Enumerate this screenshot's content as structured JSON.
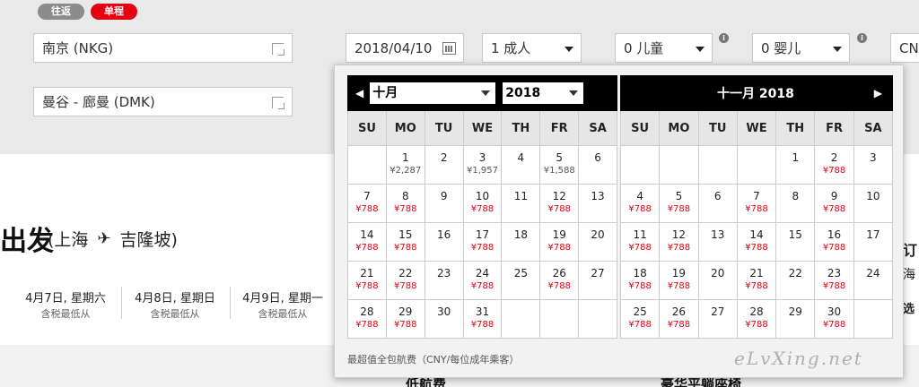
{
  "trip": {
    "roundtrip": "往返",
    "oneway": "单程"
  },
  "search": {
    "from": "南京 (NKG)",
    "to": "曼谷 - 廊曼 (DMK)",
    "date": "2018/04/10",
    "adults": "1 成人",
    "children": "0 儿童",
    "infants": "0 婴儿",
    "currency": "CNY",
    "info_glyph": "i"
  },
  "page": {
    "heading": "出发",
    "route_from": "(上海",
    "route_to": "吉隆坡)",
    "days": [
      {
        "date": "4月7日, 星期六",
        "sub": "含税最低从"
      },
      {
        "date": "4月8日, 星期日",
        "sub": "含税最低从"
      },
      {
        "date": "4月9日, 星期一",
        "sub": "含税最低从"
      }
    ],
    "bottom_left": "低航费",
    "bottom_right": "豪华平躺座椅",
    "right_peek": [
      "订",
      "海",
      "选"
    ]
  },
  "calendar": {
    "left_month": "十月",
    "left_year": "2018",
    "right_title": "十一月  2018",
    "weekdays": [
      "SU",
      "MO",
      "TU",
      "WE",
      "TH",
      "FR",
      "SA"
    ],
    "footnote": "最超值全包航费（CNY/每位成年乘客）",
    "october": [
      {
        "n": "",
        "p": ""
      },
      {
        "n": "1",
        "p": "¥2,287",
        "c": "gray"
      },
      {
        "n": "2",
        "p": ""
      },
      {
        "n": "3",
        "p": "¥1,957",
        "c": "gray"
      },
      {
        "n": "4",
        "p": ""
      },
      {
        "n": "5",
        "p": "¥1,588",
        "c": "gray"
      },
      {
        "n": "6",
        "p": ""
      },
      {
        "n": "7",
        "p": "¥788",
        "c": "red"
      },
      {
        "n": "8",
        "p": "¥788",
        "c": "red"
      },
      {
        "n": "9",
        "p": ""
      },
      {
        "n": "10",
        "p": "¥788",
        "c": "red"
      },
      {
        "n": "11",
        "p": ""
      },
      {
        "n": "12",
        "p": "¥788",
        "c": "red"
      },
      {
        "n": "13",
        "p": ""
      },
      {
        "n": "14",
        "p": "¥788",
        "c": "red"
      },
      {
        "n": "15",
        "p": "¥788",
        "c": "red"
      },
      {
        "n": "16",
        "p": ""
      },
      {
        "n": "17",
        "p": "¥788",
        "c": "red"
      },
      {
        "n": "18",
        "p": ""
      },
      {
        "n": "19",
        "p": "¥788",
        "c": "red"
      },
      {
        "n": "20",
        "p": ""
      },
      {
        "n": "21",
        "p": "¥788",
        "c": "red"
      },
      {
        "n": "22",
        "p": "¥788",
        "c": "red"
      },
      {
        "n": "23",
        "p": ""
      },
      {
        "n": "24",
        "p": "¥788",
        "c": "red"
      },
      {
        "n": "25",
        "p": ""
      },
      {
        "n": "26",
        "p": "¥788",
        "c": "red"
      },
      {
        "n": "27",
        "p": ""
      },
      {
        "n": "28",
        "p": "¥788",
        "c": "red"
      },
      {
        "n": "29",
        "p": "¥788",
        "c": "red"
      },
      {
        "n": "30",
        "p": ""
      },
      {
        "n": "31",
        "p": "¥788",
        "c": "red"
      },
      {
        "n": "",
        "p": ""
      },
      {
        "n": "",
        "p": ""
      },
      {
        "n": "",
        "p": ""
      }
    ],
    "november": [
      {
        "n": "",
        "p": ""
      },
      {
        "n": "",
        "p": ""
      },
      {
        "n": "",
        "p": ""
      },
      {
        "n": "",
        "p": ""
      },
      {
        "n": "1",
        "p": ""
      },
      {
        "n": "2",
        "p": "¥788",
        "c": "red"
      },
      {
        "n": "3",
        "p": ""
      },
      {
        "n": "4",
        "p": "¥788",
        "c": "red"
      },
      {
        "n": "5",
        "p": "¥788",
        "c": "red"
      },
      {
        "n": "6",
        "p": ""
      },
      {
        "n": "7",
        "p": "¥788",
        "c": "red"
      },
      {
        "n": "8",
        "p": ""
      },
      {
        "n": "9",
        "p": "¥788",
        "c": "red"
      },
      {
        "n": "10",
        "p": ""
      },
      {
        "n": "11",
        "p": "¥788",
        "c": "red"
      },
      {
        "n": "12",
        "p": "¥788",
        "c": "red"
      },
      {
        "n": "13",
        "p": ""
      },
      {
        "n": "14",
        "p": "¥788",
        "c": "red"
      },
      {
        "n": "15",
        "p": ""
      },
      {
        "n": "16",
        "p": "¥788",
        "c": "red"
      },
      {
        "n": "17",
        "p": ""
      },
      {
        "n": "18",
        "p": "¥788",
        "c": "red"
      },
      {
        "n": "19",
        "p": "¥788",
        "c": "red"
      },
      {
        "n": "20",
        "p": ""
      },
      {
        "n": "21",
        "p": "¥788",
        "c": "red"
      },
      {
        "n": "22",
        "p": ""
      },
      {
        "n": "23",
        "p": "¥788",
        "c": "red"
      },
      {
        "n": "24",
        "p": ""
      },
      {
        "n": "25",
        "p": "¥788",
        "c": "red"
      },
      {
        "n": "26",
        "p": "¥788",
        "c": "red"
      },
      {
        "n": "27",
        "p": ""
      },
      {
        "n": "28",
        "p": "¥788",
        "c": "red"
      },
      {
        "n": "29",
        "p": ""
      },
      {
        "n": "30",
        "p": "¥788",
        "c": "red"
      },
      {
        "n": "",
        "p": ""
      }
    ]
  },
  "watermark": "eLvXing.net",
  "colors": {
    "accent": "#e50012",
    "header": "#000000"
  }
}
